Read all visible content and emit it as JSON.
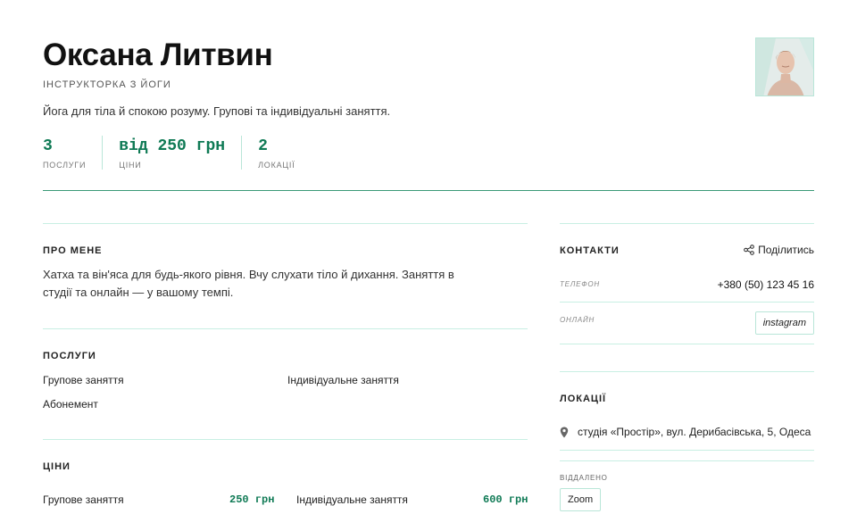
{
  "profile": {
    "name": "Оксана Литвин",
    "role": "Інструкторка з йоги",
    "tagline": "Йога для тіла й спокою розуму. Групові та індивідуальні заняття."
  },
  "stats": [
    {
      "value": "3",
      "label": "послуги"
    },
    {
      "value": "від 250 грн",
      "label": "ціни"
    },
    {
      "value": "2",
      "label": "локації"
    }
  ],
  "about": {
    "title": "Про мене",
    "line1": "Хатха та він'яса для будь-якого рівня. Вчу слухати тіло й дихання. Заняття в",
    "line2": "студії та онлайн — у вашому темпі."
  },
  "services": {
    "title": "Послуги",
    "items": [
      "Групове заняття",
      "Індивідуальне заняття",
      "Абонемент"
    ]
  },
  "prices": {
    "title": "Ціни",
    "items": [
      {
        "name": "Групове заняття",
        "price": "250 грн"
      },
      {
        "name": "Індивідуальне заняття",
        "price": "600 грн"
      }
    ]
  },
  "contacts": {
    "title": "Контакти",
    "share_label": "Поділитись",
    "phone_label": "Телефон",
    "phone": "+380 (50) 123 45 16",
    "online_label": "Онлайн",
    "online_link": "instagram"
  },
  "locations": {
    "title": "Локації",
    "address": "студія «Простір», вул. Дерибасівська, 5, Одеса",
    "remote_label": "Віддалено",
    "remote_platform": "Zoom"
  },
  "colors": {
    "accent": "#0f7a55",
    "divider": "#c8efe3",
    "main_rule": "#3a9a76"
  }
}
